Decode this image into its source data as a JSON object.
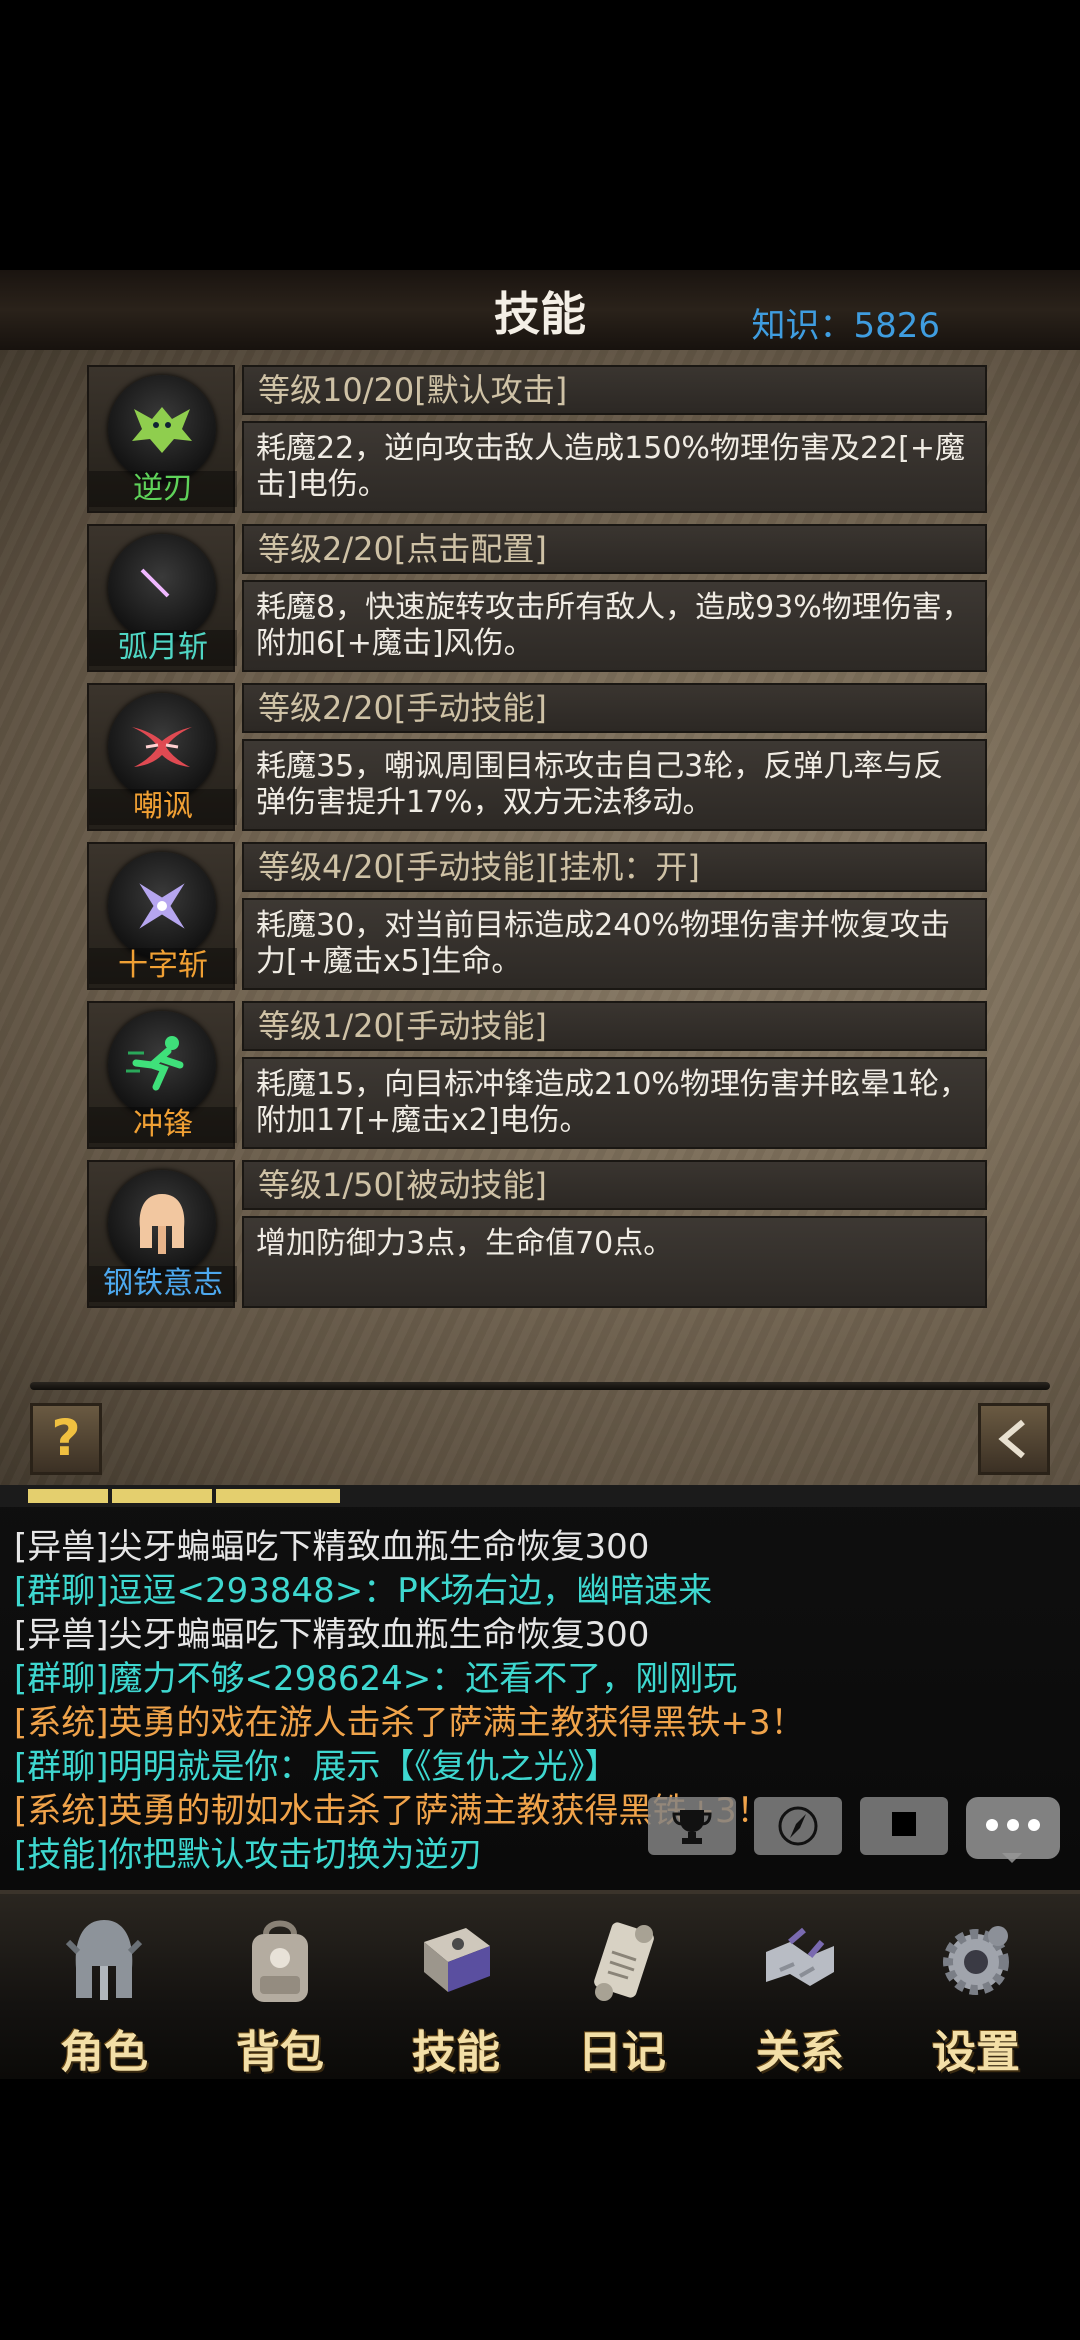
{
  "header": {
    "title": "技能",
    "knowledge": "知识：5826"
  },
  "skills": [
    {
      "name": "逆刃",
      "name_color": "#5fd35a",
      "level": "等级10/20[默认攻击]",
      "desc": "耗魔22，逆向攻击敌人造成150%物理伤害及22[+魔击]电伤。",
      "icon": "wing-creature-icon"
    },
    {
      "name": "弧月斩",
      "name_color": "#4fd6c4",
      "level": "等级2/20[点击配置]",
      "desc": "耗魔8，快速旋转攻击所有敌人，造成93%物理伤害，附加6[+魔击]风伤。",
      "icon": "crescent-slash-icon"
    },
    {
      "name": "嘲讽",
      "name_color": "#f0a034",
      "level": "等级2/20[手动技能]",
      "desc": "耗魔35，嘲讽周围目标攻击自己3轮，反弹几率与反弹伤害提升17%，双方无法移动。",
      "icon": "taunt-mask-icon"
    },
    {
      "name": "十字斩",
      "name_color": "#f0a034",
      "level": "等级4/20[手动技能][挂机：开]",
      "desc": "耗魔30，对当前目标造成240%物理伤害并恢复攻击力[+魔击x5]生命。",
      "icon": "cross-slash-icon"
    },
    {
      "name": "冲锋",
      "name_color": "#f0a034",
      "level": "等级1/20[手动技能]",
      "desc": "耗魔15，向目标冲锋造成210%物理伤害并眩晕1轮，附加17[+魔击x2]电伤。",
      "icon": "charge-runner-icon"
    },
    {
      "name": "钢铁意志",
      "name_color": "#4da8ee",
      "level": "等级1/50[被动技能]",
      "desc": "增加防御力3点，生命值70点。",
      "icon": "spartan-helmet-icon"
    }
  ],
  "buttons": {
    "help": "?",
    "back_icon": "back-arrow-icon"
  },
  "chat": [
    {
      "text": "[异兽]尖牙蝙蝠吃下精致血瓶生命恢复300",
      "color": "white"
    },
    {
      "text": "[群聊]逗逗<293848>：PK场右边，幽暗速来",
      "color": "cyan"
    },
    {
      "text": "[异兽]尖牙蝙蝠吃下精致血瓶生命恢复300",
      "color": "white"
    },
    {
      "text": "[群聊]魔力不够<298624>：还看不了，刚刚玩",
      "color": "cyan"
    },
    {
      "text": "[系统]英勇的戏在游人击杀了萨满主教获得黑铁+3！",
      "color": "orange"
    },
    {
      "text": "[群聊]明明就是你：展示【《复仇之光》】",
      "color": "cyan"
    },
    {
      "text": "[系统]英勇的韧如水击杀了萨满主教获得黑铁+3！",
      "color": "orange"
    },
    {
      "text": "[技能]你把默认攻击切换为逆刃",
      "color": "cyan"
    }
  ],
  "chat_buttons": [
    "trophy-icon",
    "compass-icon",
    "stop-icon",
    "more-icon"
  ],
  "nav": [
    {
      "label": "角色",
      "icon": "helmet-icon"
    },
    {
      "label": "背包",
      "icon": "backpack-icon"
    },
    {
      "label": "技能",
      "icon": "skill-book-icon"
    },
    {
      "label": "日记",
      "icon": "scroll-icon"
    },
    {
      "label": "关系",
      "icon": "handshake-icon"
    },
    {
      "label": "设置",
      "icon": "gear-icon"
    }
  ]
}
